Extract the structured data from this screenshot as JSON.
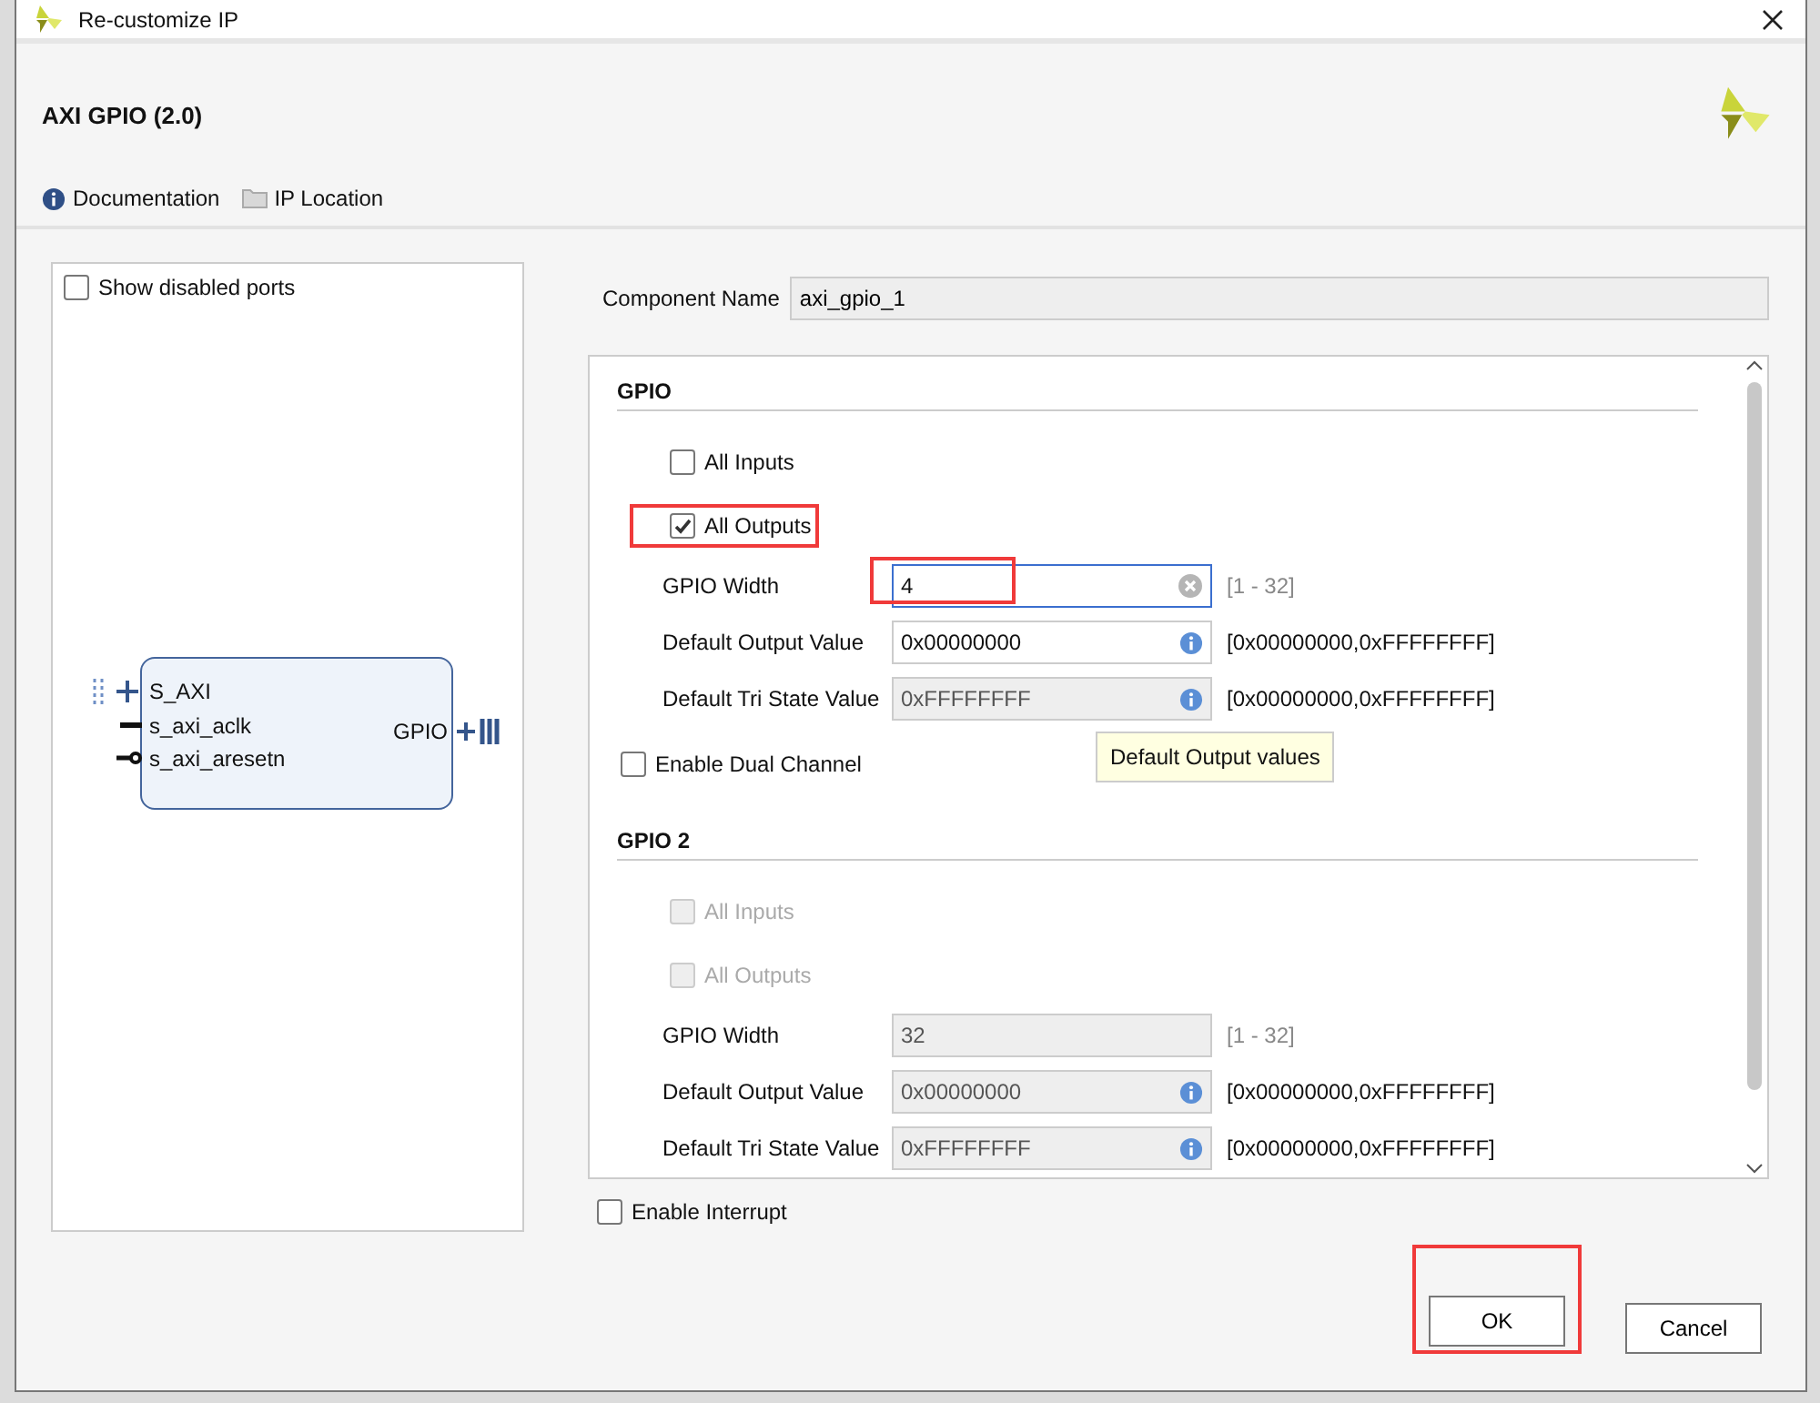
{
  "window": {
    "title": "Re-customize IP"
  },
  "header": {
    "title": "AXI GPIO (2.0)",
    "links": [
      {
        "label": "Documentation",
        "kind": "info"
      },
      {
        "label": "IP Location",
        "kind": "folder"
      }
    ]
  },
  "show_disabled_ports": {
    "label": "Show disabled ports",
    "checked": false
  },
  "block": {
    "left_ports": [
      {
        "label": "S_AXI",
        "kind": "bus"
      },
      {
        "label": "s_axi_aclk",
        "kind": "clock"
      },
      {
        "label": "s_axi_aresetn",
        "kind": "reset"
      }
    ],
    "right_ports": [
      {
        "label": "GPIO",
        "kind": "bus"
      }
    ]
  },
  "component_name": {
    "label": "Component Name",
    "value": "axi_gpio_1"
  },
  "sections": [
    {
      "title": "GPIO",
      "checkboxes": [
        {
          "label": "All Inputs",
          "checked": false,
          "disabled": false,
          "highlighted": false
        },
        {
          "label": "All Outputs",
          "checked": true,
          "disabled": false,
          "highlighted": true
        }
      ],
      "fields": [
        {
          "label": "GPIO Width",
          "value": "4",
          "hint": "[1 - 32]",
          "kind": "clearable",
          "disabled": false,
          "focused": true,
          "highlighted": true
        },
        {
          "label": "Default Output Value",
          "value": "0x00000000",
          "hint": "[0x00000000,0xFFFFFFFF]",
          "kind": "info",
          "disabled": false,
          "focused": false,
          "highlighted": false
        },
        {
          "label": "Default Tri State Value",
          "value": "0xFFFFFFFF",
          "hint": "[0x00000000,0xFFFFFFFF]",
          "kind": "info",
          "disabled": true,
          "focused": false,
          "highlighted": false
        }
      ],
      "footer_checkbox": {
        "label": "Enable Dual Channel",
        "checked": false
      }
    },
    {
      "title": "GPIO 2",
      "checkboxes": [
        {
          "label": "All Inputs",
          "checked": false,
          "disabled": true,
          "highlighted": false
        },
        {
          "label": "All Outputs",
          "checked": false,
          "disabled": true,
          "highlighted": false
        }
      ],
      "fields": [
        {
          "label": "GPIO Width",
          "value": "32",
          "hint": "[1 - 32]",
          "kind": "plain",
          "disabled": true,
          "focused": false,
          "highlighted": false
        },
        {
          "label": "Default Output Value",
          "value": "0x00000000",
          "hint": "[0x00000000,0xFFFFFFFF]",
          "kind": "info",
          "disabled": true,
          "focused": false,
          "highlighted": false
        },
        {
          "label": "Default Tri State Value",
          "value": "0xFFFFFFFF",
          "hint": "[0x00000000,0xFFFFFFFF]",
          "kind": "info",
          "disabled": true,
          "focused": false,
          "highlighted": false
        }
      ]
    }
  ],
  "tooltip": {
    "text": "Default Output values"
  },
  "enable_interrupt": {
    "label": "Enable Interrupt",
    "checked": false
  },
  "buttons": [
    {
      "label": "OK",
      "highlighted": true
    },
    {
      "label": "Cancel",
      "highlighted": false
    }
  ]
}
